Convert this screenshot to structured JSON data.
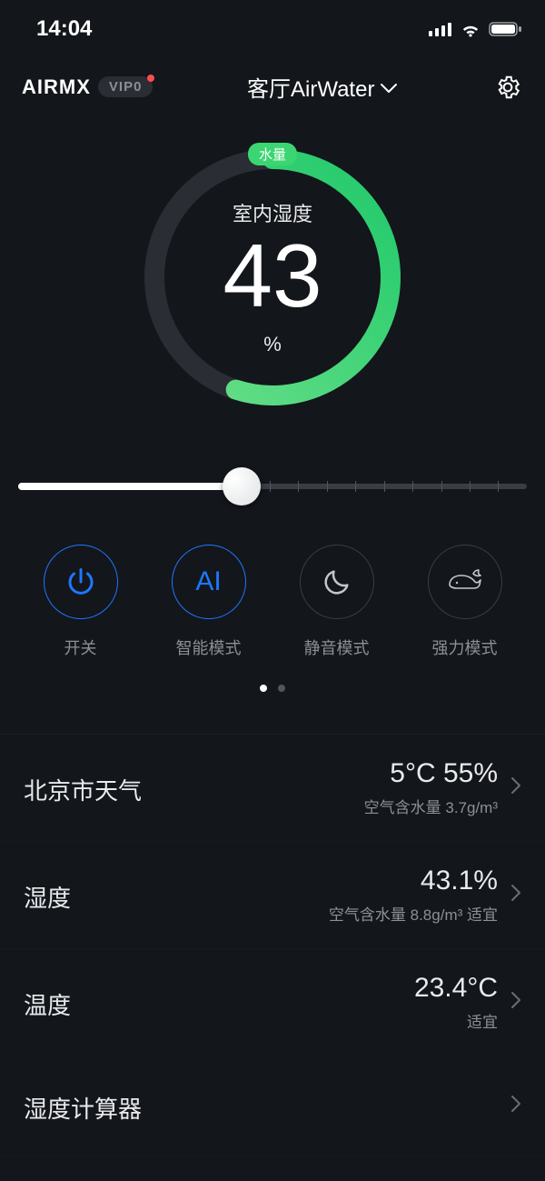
{
  "status": {
    "time": "14:04"
  },
  "header": {
    "brand": "AIRMX",
    "vip": "VIP0",
    "device": "客厅AirWater"
  },
  "gauge": {
    "water_badge": "水量",
    "label": "室内湿度",
    "value": "43",
    "unit": "%",
    "percent": 55
  },
  "slider": {
    "percent": 44
  },
  "modes": [
    {
      "key": "power",
      "label": "开关",
      "icon": "power",
      "active": true
    },
    {
      "key": "ai",
      "label": "智能模式",
      "icon": "ai",
      "active": true
    },
    {
      "key": "quiet",
      "label": "静音模式",
      "icon": "moon",
      "active": false
    },
    {
      "key": "boost",
      "label": "强力模式",
      "icon": "whale",
      "active": false
    }
  ],
  "pager": {
    "total": 2,
    "active": 0
  },
  "rows": [
    {
      "key": "weather",
      "title": "北京市天气",
      "value": "5°C 55%",
      "sub": "空气含水量 3.7g/m³"
    },
    {
      "key": "humidity",
      "title": "湿度",
      "value": "43.1%",
      "sub": "空气含水量 8.8g/m³ 适宜"
    },
    {
      "key": "temperature",
      "title": "温度",
      "value": "23.4°C",
      "sub": "适宜"
    },
    {
      "key": "calculator",
      "title": "湿度计算器",
      "value": "",
      "sub": ""
    }
  ]
}
